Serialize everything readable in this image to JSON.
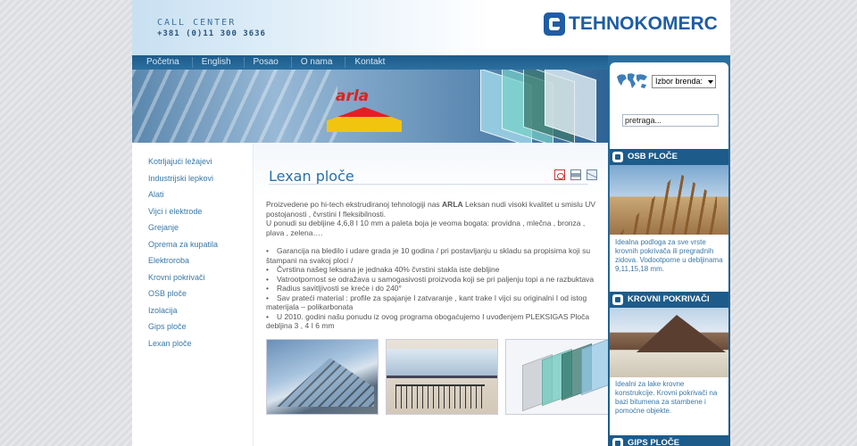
{
  "header": {
    "call_center_label": "CALL CENTER",
    "call_center_number": "+381 (0)11 300 3636",
    "logo_text": "TEHNOKOMERC"
  },
  "nav": {
    "items": [
      "Početna",
      "English",
      "Posao",
      "O nama",
      "Kontakt"
    ]
  },
  "banner": {
    "brand": "arla"
  },
  "sidebar": {
    "items": [
      "Kotrljajući ležajevi",
      "Industrijski lepkovi",
      "Alati",
      "Vijci i elektrode",
      "Grejanje",
      "Oprema za kupatila",
      "Elektroroba",
      "Krovni pokrivači",
      "OSB ploče",
      "Izolacija",
      "Gips ploče",
      "Lexan ploče"
    ]
  },
  "content": {
    "title": "Lexan ploče",
    "intro_before": "Proizvedene po hi-tech ekstrudiranoj tehnologiji nas ",
    "intro_brand": "ARLA",
    "intro_after": " Leksan nudi visoki kvalitet u smislu UV postojanosti , čvrstini I fleksibilnosti.",
    "intro_line2": "U ponudi su debljine 4,6,8 I 10 mm a paleta boja je veoma bogata: providna , mlečna , bronza , plava , zelena….",
    "bullets": [
      "Garancija na bledilo i udare grada je 10 godina / pri postavljanju u skladu sa propisima koji su štampani na svakoj ploci /",
      "Čvrstina našeg leksana je jednaka 40% čvrstini stakla iste debljine",
      "Vatrootpornost se odražava u samogasivosti proizvoda koji se pri paljenju topi a ne razbuktava",
      "Radius savitljivosti se kreće i do 240°",
      "Sav prateći material : profile za spajanje I zatvaranje , kant trake I vijci su originalni I od istog materijala – polikarbonata",
      "U 2010. godini našu ponudu iz ovog programa obogaćujemo I uvođenjem PLEKSIGAS Ploča debljina 3 , 4 I 6 mm"
    ]
  },
  "right": {
    "brand_select_value": "Izbor brenda:",
    "search_value": "pretraga...",
    "promos": [
      {
        "title": "OSB PLOČE",
        "text": "Idealna podloga za sve vrste krovnih pokrivača ili pregradnih zidova. Vodootporne u debljinama 9,11,15,18 mm."
      },
      {
        "title": "KROVNI POKRIVAČI",
        "text": "Idealni za lake krovne konstrukcije. Krovni pokrivači na bazi bitumena za stambene i pomoćne objekte."
      },
      {
        "title": "GIPS PLOČE",
        "text": ""
      }
    ]
  },
  "colors": {
    "nav_bg": "#1d5b8a",
    "link": "#3a78a8",
    "title": "#2b6fa6",
    "logo": "#1f5da5"
  }
}
